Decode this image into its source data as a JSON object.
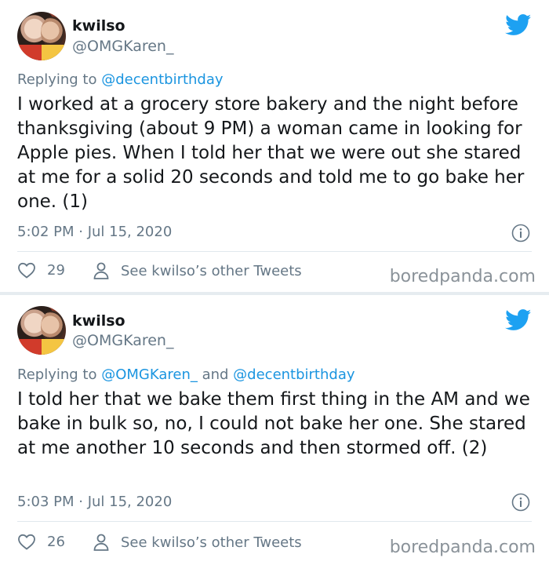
{
  "tweets": [
    {
      "display_name": "kwilso",
      "handle": "@OMGKaren_",
      "replying_prefix": "Replying to ",
      "replying_mentions": [
        "@decentbirthday"
      ],
      "replying_joiner": "",
      "text": "I worked at a grocery store bakery and the night before thanksgiving (about 9 PM) a woman came in looking for Apple pies. When I told her that we were out she stared at me for a solid 20 seconds and told me to go bake her one. (1)",
      "timestamp": "5:02 PM · Jul 15, 2020",
      "likes": "29",
      "others_label": "See kwilso’s other Tweets"
    },
    {
      "display_name": "kwilso",
      "handle": "@OMGKaren_",
      "replying_prefix": "Replying to ",
      "replying_mentions": [
        "@OMGKaren_",
        "@decentbirthday"
      ],
      "replying_joiner": " and ",
      "text": "I told her that we bake them first thing in the AM and we bake in bulk so, no, I could not bake her one. She stared at me another 10 seconds and then stormed off. (2)",
      "timestamp": "5:03 PM · Jul 15, 2020",
      "likes": "26",
      "others_label": "See kwilso’s other Tweets"
    }
  ],
  "watermark": "boredpanda.com",
  "colors": {
    "twitter_blue": "#1da1f2",
    "mention_blue": "#1b95e0",
    "secondary_text": "#657786"
  },
  "icons": [
    "twitter-bird-icon",
    "info-icon",
    "heart-icon",
    "person-icon"
  ]
}
